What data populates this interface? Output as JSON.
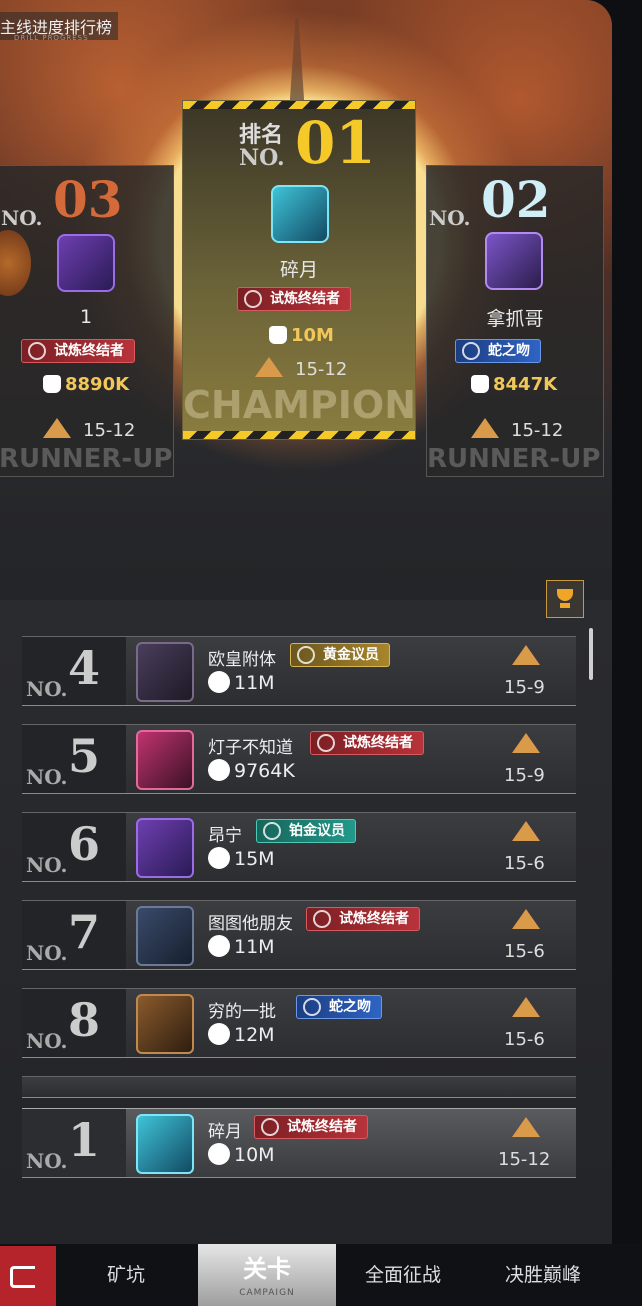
{
  "header": {
    "title": "主线进度排行榜",
    "subtitle": "DRILL PROGRESS"
  },
  "top3": [
    {
      "rank": "03",
      "no_label": "NO.",
      "name": "1",
      "title": "试炼终结者",
      "title_color": "red",
      "power": "8890K",
      "stage": "15-12",
      "footer": "RUNNER-UP"
    },
    {
      "rank": "01",
      "no_label": "NO.",
      "rank_prefix": "排名",
      "name": "碎月",
      "title": "试炼终结者",
      "title_color": "red",
      "power": "10M",
      "stage": "15-12",
      "footer": "CHAMPION"
    },
    {
      "rank": "02",
      "no_label": "NO.",
      "name": "拿抓哥",
      "title": "蛇之吻",
      "title_color": "blue",
      "power": "8447K",
      "stage": "15-12",
      "footer": "RUNNER-UP"
    }
  ],
  "list": [
    {
      "rank": "4",
      "name": "欧皇附体",
      "title": "黄金议员",
      "title_color": "gold",
      "power": "11M",
      "stage": "15-9"
    },
    {
      "rank": "5",
      "name": "灯子不知道",
      "title": "试炼终结者",
      "title_color": "red",
      "power": "9764K",
      "stage": "15-9"
    },
    {
      "rank": "6",
      "name": "昂宁",
      "title": "铂金议员",
      "title_color": "teal",
      "power": "15M",
      "stage": "15-6"
    },
    {
      "rank": "7",
      "name": "图图他朋友",
      "title": "试炼终结者",
      "title_color": "red",
      "power": "11M",
      "stage": "15-6"
    },
    {
      "rank": "8",
      "name": "穷的一批",
      "title": "蛇之吻",
      "title_color": "blue",
      "power": "12M",
      "stage": "15-6"
    }
  ],
  "self": {
    "rank": "1",
    "name": "碎月",
    "title": "试炼终结者",
    "title_color": "red",
    "power": "10M",
    "stage": "15-12"
  },
  "no_label": "NO.",
  "tabs": [
    {
      "label": "矿坑"
    },
    {
      "label": "关卡",
      "sub": "CAMPAIGN",
      "active": true
    },
    {
      "label": "全面征战"
    },
    {
      "label": "决胜巅峰"
    }
  ],
  "colors": {
    "gold_rank": "#f5c928",
    "bronze_rank": "#d46a3a",
    "silver_rank": "#cfeef5",
    "power": "#f1c75a",
    "back": "#b4242a"
  }
}
